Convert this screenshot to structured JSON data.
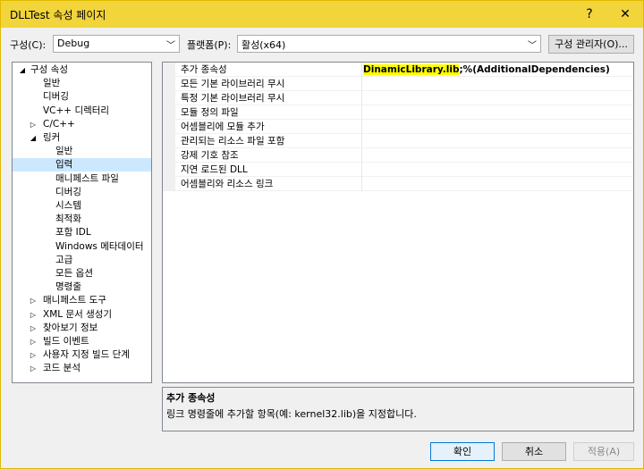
{
  "window": {
    "title": "DLLTest 속성 페이지",
    "help": "?",
    "close": "✕"
  },
  "toolbar": {
    "config_label": "구성(C):",
    "config_value": "Debug",
    "platform_label": "플랫폼(P):",
    "platform_value": "활성(x64)",
    "config_manager": "구성 관리자(O)..."
  },
  "tree": {
    "items": [
      {
        "label": "구성 속성",
        "twisty": "◢"
      },
      {
        "label": "일반",
        "twisty": ""
      },
      {
        "label": "디버깅",
        "twisty": ""
      },
      {
        "label": "VC++ 디렉터리",
        "twisty": ""
      },
      {
        "label": "C/C++",
        "twisty": "▷"
      },
      {
        "label": "링커",
        "twisty": "◢"
      },
      {
        "label": "일반",
        "twisty": ""
      },
      {
        "label": "입력",
        "twisty": ""
      },
      {
        "label": "매니페스트 파일",
        "twisty": ""
      },
      {
        "label": "디버깅",
        "twisty": ""
      },
      {
        "label": "시스템",
        "twisty": ""
      },
      {
        "label": "최적화",
        "twisty": ""
      },
      {
        "label": "포함 IDL",
        "twisty": ""
      },
      {
        "label": "Windows 메타데이터",
        "twisty": ""
      },
      {
        "label": "고급",
        "twisty": ""
      },
      {
        "label": "모든 옵션",
        "twisty": ""
      },
      {
        "label": "명령줄",
        "twisty": ""
      },
      {
        "label": "매니페스트 도구",
        "twisty": "▷"
      },
      {
        "label": "XML 문서 생성기",
        "twisty": "▷"
      },
      {
        "label": "찾아보기 정보",
        "twisty": "▷"
      },
      {
        "label": "빌드 이벤트",
        "twisty": "▷"
      },
      {
        "label": "사용자 지정 빌드 단계",
        "twisty": "▷"
      },
      {
        "label": "코드 분석",
        "twisty": "▷"
      }
    ]
  },
  "grid": {
    "rows": [
      {
        "name": "추가 종속성",
        "value_hl": "DinamicLibrary.lib",
        "value_rest": ";%(AdditionalDependencies)"
      },
      {
        "name": "모든 기본 라이브러리 무시",
        "value_hl": "",
        "value_rest": ""
      },
      {
        "name": "특정 기본 라이브러리 무시",
        "value_hl": "",
        "value_rest": ""
      },
      {
        "name": "모듈 정의 파일",
        "value_hl": "",
        "value_rest": ""
      },
      {
        "name": "어셈블리에 모듈 추가",
        "value_hl": "",
        "value_rest": ""
      },
      {
        "name": "관리되는 리소스 파일 포함",
        "value_hl": "",
        "value_rest": ""
      },
      {
        "name": "강제 기호 참조",
        "value_hl": "",
        "value_rest": ""
      },
      {
        "name": "지연 로드된 DLL",
        "value_hl": "",
        "value_rest": ""
      },
      {
        "name": "어셈블리와 리소스 링크",
        "value_hl": "",
        "value_rest": ""
      }
    ]
  },
  "description": {
    "title": "추가 종속성",
    "text": "링크 명령줄에 추가할 항목(예: kernel32.lib)을 지정합니다."
  },
  "buttons": {
    "ok": "확인",
    "cancel": "취소",
    "apply": "적용(A)"
  }
}
